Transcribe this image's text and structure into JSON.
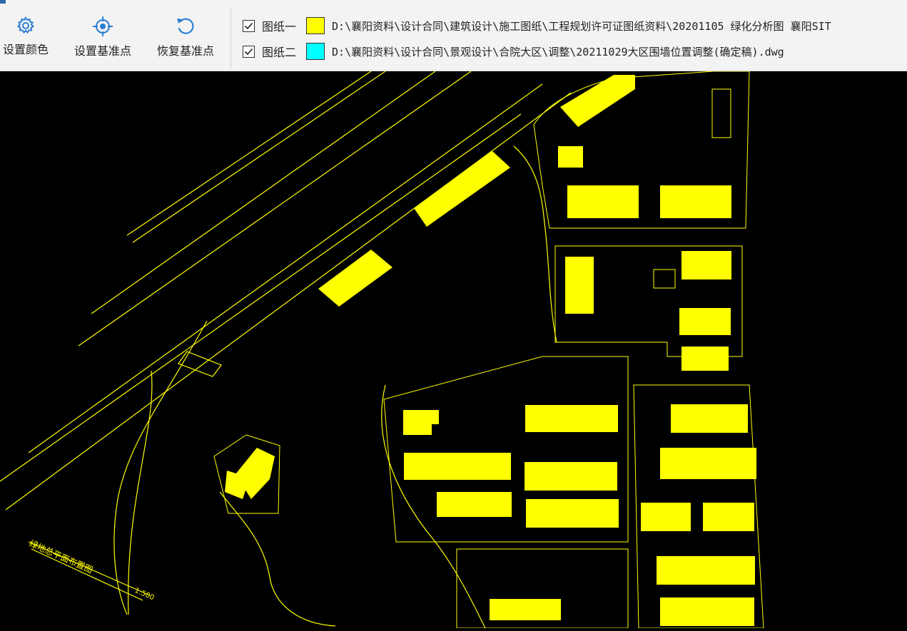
{
  "toolbar": {
    "set_color_label": "设置颜色",
    "set_base_point_label": "设置基准点",
    "restore_base_point_label": "恢复基准点",
    "icon_color": "#2a7fd4"
  },
  "drawings": [
    {
      "label": "图纸一",
      "checked": true,
      "color": "#ffff00",
      "path": "D:\\襄阳资料\\设计合同\\建筑设计\\施工图纸\\工程规划许可证图纸资料\\20201105 绿化分析图 襄阳SIT"
    },
    {
      "label": "图纸二",
      "checked": true,
      "color": "#00ffff",
      "path": "D:\\襄阳资料\\设计合同\\景观设计\\合院大区\\调整\\20211029大区围墙位置调整(确定稿).dwg"
    }
  ],
  "cad": {
    "background": "#000000",
    "line_color": "#ffff00",
    "plan_title": "绿地总平面布置图",
    "scale_label": "1:500"
  }
}
